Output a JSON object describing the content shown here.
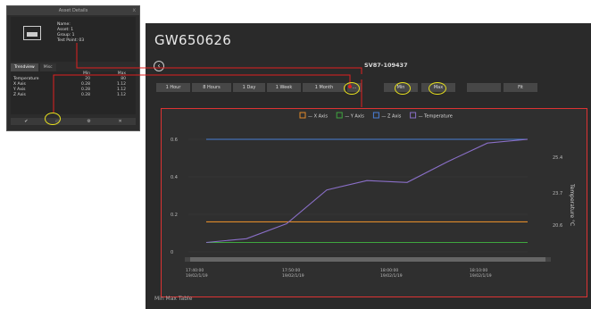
{
  "panel": {
    "title": "Asset Details",
    "close": "x",
    "info": [
      "Name:",
      "Asset: 1",
      "Group: 1",
      "Test Point: 03"
    ],
    "tabs": [
      "Trendview",
      "Misc"
    ],
    "table": {
      "headers": [
        "",
        "Min",
        "Max"
      ],
      "rows": [
        [
          "Temperature",
          "20",
          "80"
        ],
        [
          "X Axis",
          "0.28",
          "1.12"
        ],
        [
          "Y Axis",
          "0.28",
          "1.12"
        ],
        [
          "Z Axis",
          "0.28",
          "1.12"
        ]
      ]
    },
    "bottom_icons": [
      "✔",
      "▭",
      "⚙",
      "✕"
    ]
  },
  "window": {
    "title": "GW650626",
    "back": "‹",
    "sensor": "SV87-109437",
    "ranges": [
      "1 Hour",
      "8 Hours",
      "1 Day",
      "1 Week",
      "1 Month"
    ],
    "range_more": "...",
    "ctl": [
      "Min",
      "Max",
      "",
      "Fit"
    ],
    "footer": "Min Max Table"
  },
  "colors": {
    "x_axis": "#e08a2a",
    "y_axis": "#3fa63f",
    "z_axis": "#4a7fd6",
    "temperature": "#8a6fc8",
    "annotation": "#e02020",
    "highlight": "#e6df1e"
  },
  "chart_data": {
    "type": "line",
    "legend": [
      "X Axis",
      "Y Axis",
      "Z Axis",
      "Temperature"
    ],
    "legend_position": "top-center",
    "y_left_ticks": [
      "0.6",
      "0.4",
      "0.2",
      "0"
    ],
    "y_left_range": [
      0,
      0.6
    ],
    "y_right_label": "Temperature °C",
    "y_right_ticks": [
      "25.4",
      "23.7",
      "20.6"
    ],
    "x_ticks": [
      [
        "17:40:00",
        "19/02/1/19"
      ],
      [
        "17:50:00",
        "19/02/1/19"
      ],
      [
        "18:00:00",
        "19/02/1/19"
      ],
      [
        "18:10:00",
        "19/02/1/19"
      ]
    ],
    "grid": true,
    "series": [
      {
        "name": "Z Axis",
        "axis": "left",
        "y": [
          0.6,
          0.6,
          0.6,
          0.6,
          0.6,
          0.6,
          0.6
        ]
      },
      {
        "name": "X Axis",
        "axis": "left",
        "y": [
          0.16,
          0.16,
          0.16,
          0.16,
          0.16,
          0.16,
          0.16
        ]
      },
      {
        "name": "Y Axis",
        "axis": "left",
        "y": [
          0.05,
          0.05,
          0.05,
          0.05,
          0.05,
          0.05,
          0.05
        ]
      },
      {
        "name": "Temperature",
        "axis": "right",
        "y": [
          0.05,
          0.07,
          0.15,
          0.33,
          0.38,
          0.37,
          0.48,
          0.58,
          0.6
        ]
      }
    ]
  }
}
